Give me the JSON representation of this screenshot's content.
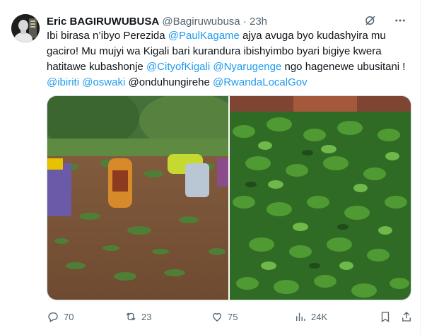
{
  "author": {
    "name": "Eric BAGIRUWUBUSA",
    "handle": "@Bagiruwubusa",
    "separator": "·",
    "time": "23h"
  },
  "tweet": {
    "line1_a": "Ibi birasa n’ibyo Perezida ",
    "mention_paul": "@PaulKagame",
    "line1_b": " ajya avuga byo kudashyira mu",
    "line2": "gaciro! Mu mujyi wa Kigali bari kurandura ibishyimbo byari bigiye kwera",
    "line3_a": "hatitawe kubashonje ",
    "mention_city": "@CityofKigali",
    "mention_nyarugenge": "@Nyarugenge",
    "line3_b": " ngo hagenewe ubusitani !",
    "mention_ibiriti": "@ibiriti",
    "mention_oswaki": "@oswaki",
    "plain_onduhungirehe": "@onduhungirehe",
    "mention_rwanda": "@RwandaLocalGov"
  },
  "actions": {
    "replies": "70",
    "reposts": "23",
    "likes": "75",
    "views": "24K"
  },
  "colors": {
    "link": "#1d9bf0",
    "secondary": "#536471",
    "border": "#cfd9de"
  },
  "icons": [
    "grok-icon",
    "more-icon",
    "reply-icon",
    "repost-icon",
    "like-icon",
    "views-icon",
    "bookmark-icon",
    "share-icon"
  ]
}
